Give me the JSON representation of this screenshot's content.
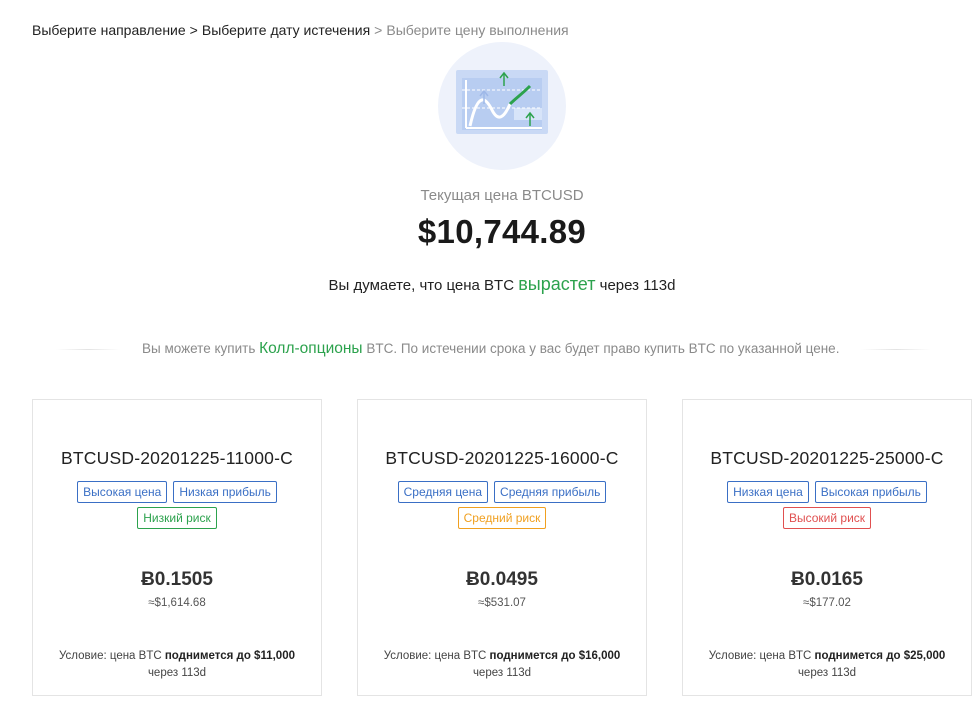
{
  "breadcrumb": {
    "step1": "Выберите направление",
    "step2": "Выберите дату истечения",
    "step3": "Выберите цену выполнения",
    "separator": ">"
  },
  "hero": {
    "icon": "rising-chart-icon"
  },
  "price": {
    "label": "Текущая цена BTCUSD",
    "value": "$10,744.89"
  },
  "prediction": {
    "prefix": "Вы думаете, что цена BTC",
    "direction": "вырастет",
    "suffix": "через 113d"
  },
  "info": {
    "prefix": "Вы можете купить",
    "link": "Колл-опционы",
    "suffix": "BTC. По истечении срока у вас будет право купить BTC по указанной цене."
  },
  "colors": {
    "accent_green": "#2ca24d",
    "tag_blue": "#3a6fc5",
    "tag_orange": "#f0a020",
    "tag_red": "#e05050"
  },
  "cards": [
    {
      "title": "BTCUSD-20201225-11000-C",
      "tags": [
        "Высокая цена",
        "Низкая прибыль"
      ],
      "risk": "Низкий риск",
      "premium": "Ƀ0.1505",
      "usd": "≈$1,614.68",
      "cond_prefix": "Условие: цена BTC",
      "cond_bold": "поднимется до $11,000",
      "cond_suffix": "через 113d"
    },
    {
      "title": "BTCUSD-20201225-16000-C",
      "tags": [
        "Средняя цена",
        "Средняя прибыль"
      ],
      "risk": "Средний риск",
      "premium": "Ƀ0.0495",
      "usd": "≈$531.07",
      "cond_prefix": "Условие: цена BTC",
      "cond_bold": "поднимется до $16,000",
      "cond_suffix": "через 113d"
    },
    {
      "title": "BTCUSD-20201225-25000-C",
      "tags": [
        "Низкая цена",
        "Высокая прибыль"
      ],
      "risk": "Высокий риск",
      "premium": "Ƀ0.0165",
      "usd": "≈$177.02",
      "cond_prefix": "Условие: цена BTC",
      "cond_bold": "поднимется до $25,000",
      "cond_suffix": "через 113d"
    }
  ]
}
